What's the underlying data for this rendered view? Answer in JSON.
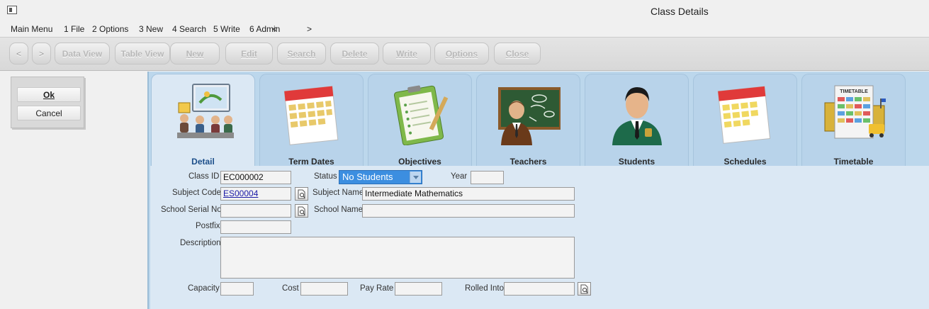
{
  "window": {
    "title": "Class Details"
  },
  "menu": [
    "Main Menu",
    "1 File",
    "2 Options",
    "3 New",
    "4 Search",
    "5 Write",
    "6 Admin",
    "<",
    ">"
  ],
  "toolbar": {
    "prev": "<",
    "next": ">",
    "data_view": "Data View",
    "table_view": "Table View",
    "new": "New",
    "edit": "Edit",
    "search": "Search",
    "delete": "Delete",
    "write": "Write",
    "options": "Options",
    "close": "Close"
  },
  "dialog": {
    "ok": "Ok",
    "cancel": "Cancel"
  },
  "tabs": [
    "Detail",
    "Term Dates",
    "Objectives",
    "Teachers",
    "Students",
    "Schedules",
    "Timetable"
  ],
  "tab_art": {
    "timetable_caption": "TIMETABLE"
  },
  "form": {
    "class_id_label": "Class ID",
    "class_id": "EC000002",
    "status_label": "Status",
    "status": "No Students",
    "year_label": "Year",
    "year": "",
    "subject_code_label": "Subject Code",
    "subject_code": "ES00004",
    "subject_name_label": "Subject Name",
    "subject_name": "Intermediate Mathematics",
    "school_serial_label": "School Serial No",
    "school_serial": "",
    "school_name_label": "School Name",
    "school_name": "",
    "postfix_label": "Postfix",
    "postfix": "",
    "description_label": "Description",
    "description": "",
    "capacity_label": "Capacity",
    "capacity": "",
    "cost_label": "Cost",
    "cost": "",
    "pay_rate_label": "Pay Rate",
    "pay_rate": "",
    "rolled_into_label": "Rolled Into",
    "rolled_into": ""
  }
}
